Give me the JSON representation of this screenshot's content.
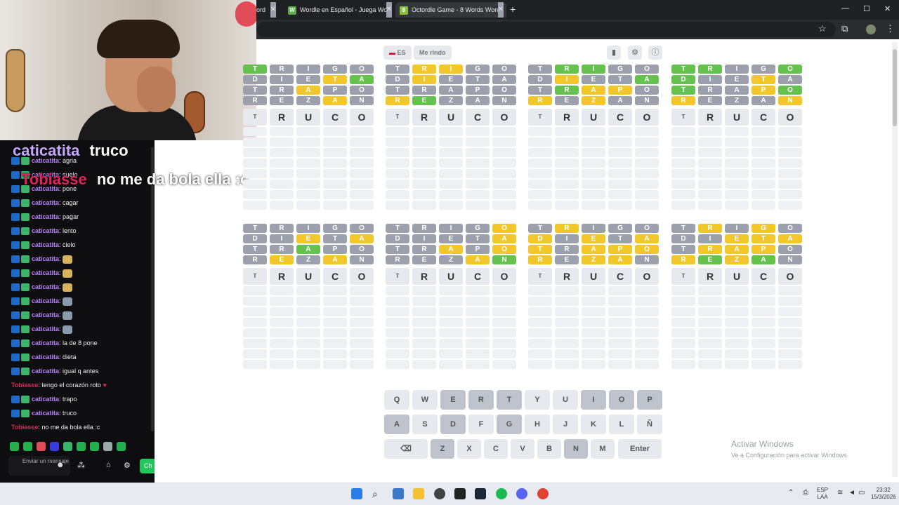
{
  "browser": {
    "tabs": [
      {
        "title": "ord",
        "active": false
      },
      {
        "title": "Wordle en Español - Juega Wor",
        "active": false
      },
      {
        "title": "Octordle Game - 8 Words Word",
        "active": true
      }
    ],
    "new_tab": "+",
    "window_controls": {
      "minimize": "—",
      "maximize": "☐",
      "close": "✕"
    }
  },
  "header": {
    "language": "ES",
    "give_up": "Me rindo",
    "icons": [
      "stats-icon",
      "settings-icon",
      "info-icon"
    ]
  },
  "boards": [
    {
      "rows": [
        [
          [
            "T",
            "g"
          ],
          [
            "R",
            "x"
          ],
          [
            "I",
            "x"
          ],
          [
            "G",
            "x"
          ],
          [
            "O",
            "x"
          ]
        ],
        [
          [
            "D",
            "x"
          ],
          [
            "I",
            "x"
          ],
          [
            "E",
            "x"
          ],
          [
            "T",
            "y"
          ],
          [
            "A",
            "g"
          ]
        ],
        [
          [
            "T",
            "x"
          ],
          [
            "R",
            "x"
          ],
          [
            "A",
            "y"
          ],
          [
            "P",
            "x"
          ],
          [
            "O",
            "x"
          ]
        ],
        [
          [
            "R",
            "x"
          ],
          [
            "E",
            "x"
          ],
          [
            "Z",
            "x"
          ],
          [
            "A",
            "y"
          ],
          [
            "N",
            "x"
          ]
        ]
      ]
    },
    {
      "rows": [
        [
          [
            "T",
            "x"
          ],
          [
            "R",
            "y"
          ],
          [
            "I",
            "y"
          ],
          [
            "G",
            "x"
          ],
          [
            "O",
            "x"
          ]
        ],
        [
          [
            "D",
            "x"
          ],
          [
            "I",
            "y"
          ],
          [
            "E",
            "x"
          ],
          [
            "T",
            "x"
          ],
          [
            "A",
            "x"
          ]
        ],
        [
          [
            "T",
            "x"
          ],
          [
            "R",
            "x"
          ],
          [
            "A",
            "x"
          ],
          [
            "P",
            "x"
          ],
          [
            "O",
            "x"
          ]
        ],
        [
          [
            "R",
            "y"
          ],
          [
            "E",
            "g"
          ],
          [
            "Z",
            "x"
          ],
          [
            "A",
            "x"
          ],
          [
            "N",
            "x"
          ]
        ]
      ]
    },
    {
      "rows": [
        [
          [
            "T",
            "x"
          ],
          [
            "R",
            "g"
          ],
          [
            "I",
            "g"
          ],
          [
            "G",
            "x"
          ],
          [
            "O",
            "x"
          ]
        ],
        [
          [
            "D",
            "x"
          ],
          [
            "I",
            "y"
          ],
          [
            "E",
            "x"
          ],
          [
            "T",
            "x"
          ],
          [
            "A",
            "g"
          ]
        ],
        [
          [
            "T",
            "x"
          ],
          [
            "R",
            "g"
          ],
          [
            "A",
            "y"
          ],
          [
            "P",
            "y"
          ],
          [
            "O",
            "x"
          ]
        ],
        [
          [
            "R",
            "y"
          ],
          [
            "E",
            "x"
          ],
          [
            "Z",
            "y"
          ],
          [
            "A",
            "x"
          ],
          [
            "N",
            "x"
          ]
        ]
      ]
    },
    {
      "rows": [
        [
          [
            "T",
            "g"
          ],
          [
            "R",
            "g"
          ],
          [
            "I",
            "x"
          ],
          [
            "G",
            "x"
          ],
          [
            "O",
            "g"
          ]
        ],
        [
          [
            "D",
            "g"
          ],
          [
            "I",
            "x"
          ],
          [
            "E",
            "x"
          ],
          [
            "T",
            "y"
          ],
          [
            "A",
            "x"
          ]
        ],
        [
          [
            "T",
            "g"
          ],
          [
            "R",
            "x"
          ],
          [
            "A",
            "x"
          ],
          [
            "P",
            "y"
          ],
          [
            "O",
            "g"
          ]
        ],
        [
          [
            "R",
            "y"
          ],
          [
            "E",
            "x"
          ],
          [
            "Z",
            "x"
          ],
          [
            "A",
            "x"
          ],
          [
            "N",
            "y"
          ]
        ]
      ]
    },
    {
      "rows": [
        [
          [
            "T",
            "x"
          ],
          [
            "R",
            "x"
          ],
          [
            "I",
            "x"
          ],
          [
            "G",
            "x"
          ],
          [
            "O",
            "x"
          ]
        ],
        [
          [
            "D",
            "x"
          ],
          [
            "I",
            "x"
          ],
          [
            "E",
            "y"
          ],
          [
            "T",
            "x"
          ],
          [
            "A",
            "y"
          ]
        ],
        [
          [
            "T",
            "x"
          ],
          [
            "R",
            "x"
          ],
          [
            "A",
            "g"
          ],
          [
            "P",
            "x"
          ],
          [
            "O",
            "x"
          ]
        ],
        [
          [
            "R",
            "x"
          ],
          [
            "E",
            "y"
          ],
          [
            "Z",
            "x"
          ],
          [
            "A",
            "y"
          ],
          [
            "N",
            "x"
          ]
        ]
      ]
    },
    {
      "rows": [
        [
          [
            "T",
            "x"
          ],
          [
            "R",
            "x"
          ],
          [
            "I",
            "x"
          ],
          [
            "G",
            "x"
          ],
          [
            "O",
            "y"
          ]
        ],
        [
          [
            "D",
            "x"
          ],
          [
            "I",
            "x"
          ],
          [
            "E",
            "x"
          ],
          [
            "T",
            "x"
          ],
          [
            "A",
            "y"
          ]
        ],
        [
          [
            "T",
            "x"
          ],
          [
            "R",
            "x"
          ],
          [
            "A",
            "y"
          ],
          [
            "P",
            "x"
          ],
          [
            "O",
            "y"
          ]
        ],
        [
          [
            "R",
            "x"
          ],
          [
            "E",
            "x"
          ],
          [
            "Z",
            "x"
          ],
          [
            "A",
            "y"
          ],
          [
            "N",
            "g"
          ]
        ]
      ]
    },
    {
      "rows": [
        [
          [
            "T",
            "x"
          ],
          [
            "R",
            "y"
          ],
          [
            "I",
            "x"
          ],
          [
            "G",
            "x"
          ],
          [
            "O",
            "x"
          ]
        ],
        [
          [
            "D",
            "y"
          ],
          [
            "I",
            "x"
          ],
          [
            "E",
            "y"
          ],
          [
            "T",
            "x"
          ],
          [
            "A",
            "y"
          ]
        ],
        [
          [
            "T",
            "y"
          ],
          [
            "R",
            "x"
          ],
          [
            "A",
            "y"
          ],
          [
            "P",
            "y"
          ],
          [
            "O",
            "y"
          ]
        ],
        [
          [
            "R",
            "y"
          ],
          [
            "E",
            "x"
          ],
          [
            "Z",
            "y"
          ],
          [
            "A",
            "y"
          ],
          [
            "N",
            "x"
          ]
        ]
      ]
    },
    {
      "rows": [
        [
          [
            "T",
            "x"
          ],
          [
            "R",
            "y"
          ],
          [
            "I",
            "x"
          ],
          [
            "G",
            "y"
          ],
          [
            "O",
            "x"
          ]
        ],
        [
          [
            "D",
            "x"
          ],
          [
            "I",
            "x"
          ],
          [
            "E",
            "y"
          ],
          [
            "T",
            "y"
          ],
          [
            "A",
            "y"
          ]
        ],
        [
          [
            "T",
            "x"
          ],
          [
            "R",
            "y"
          ],
          [
            "A",
            "y"
          ],
          [
            "P",
            "y"
          ],
          [
            "O",
            "x"
          ]
        ],
        [
          [
            "R",
            "y"
          ],
          [
            "E",
            "g"
          ],
          [
            "Z",
            "y"
          ],
          [
            "A",
            "g"
          ],
          [
            "N",
            "x"
          ]
        ]
      ]
    }
  ],
  "current_guess": [
    "T",
    "R",
    "U",
    "C",
    "O"
  ],
  "keyboard": {
    "row1": [
      "Q",
      "W",
      "E",
      "R",
      "T",
      "Y",
      "U",
      "I",
      "O",
      "P"
    ],
    "row2": [
      "A",
      "S",
      "D",
      "F",
      "G",
      "H",
      "J",
      "K",
      "L",
      "Ñ"
    ],
    "row3_letters": [
      "Z",
      "X",
      "C",
      "V",
      "B",
      "N",
      "M"
    ],
    "backspace": "⌫",
    "enter": "Enter"
  },
  "watermark": {
    "line1": "Activar Windows",
    "line2": "Ve a Configuración para activar Windows."
  },
  "chat": {
    "overlay_big": [
      {
        "user": "caticatita",
        "text": "truco"
      },
      {
        "user": "Tobiasse",
        "text": "no me da bola ella :c"
      }
    ],
    "messages": [
      {
        "user": "caticatita",
        "text": "agria",
        "type": "cat"
      },
      {
        "user": "caticatita",
        "text": "suelo",
        "type": "cat"
      },
      {
        "user": "caticatita",
        "text": "pone",
        "type": "cat"
      },
      {
        "user": "caticatita",
        "text": "cagar",
        "type": "cat"
      },
      {
        "user": "caticatita",
        "text": "pagar",
        "type": "cat"
      },
      {
        "user": "caticatita",
        "text": "lento",
        "type": "cat"
      },
      {
        "user": "caticatita",
        "text": "cielo",
        "type": "cat"
      },
      {
        "user": "caticatita",
        "text": "",
        "type": "cat-emote"
      },
      {
        "user": "caticatita",
        "text": "",
        "type": "cat-emote"
      },
      {
        "user": "caticatita",
        "text": "",
        "type": "cat-emote"
      },
      {
        "user": "caticatita",
        "text": "",
        "type": "cat-rat"
      },
      {
        "user": "caticatita",
        "text": "",
        "type": "cat-rat"
      },
      {
        "user": "caticatita",
        "text": "",
        "type": "cat-rat"
      },
      {
        "user": "caticatita",
        "text": "la de 8 pone",
        "type": "cat"
      },
      {
        "user": "caticatita",
        "text": "dieta",
        "type": "cat"
      },
      {
        "user": "caticatita",
        "text": "igual q antes",
        "type": "cat"
      },
      {
        "user": "Tobiasse",
        "text": "tengo el corazón roto",
        "type": "tob-heart"
      },
      {
        "user": "caticatita",
        "text": "trapo",
        "type": "cat"
      },
      {
        "user": "caticatita",
        "text": "truco",
        "type": "cat"
      },
      {
        "user": "Tobiasse",
        "text": "no me da bola ella :c",
        "type": "tob"
      }
    ],
    "input_placeholder": "Enviar un mensaje",
    "send_button": "Ch"
  },
  "taskbar": {
    "lang": "ESP",
    "region": "LAA",
    "time": "23:32",
    "date": "15/3/2026"
  }
}
